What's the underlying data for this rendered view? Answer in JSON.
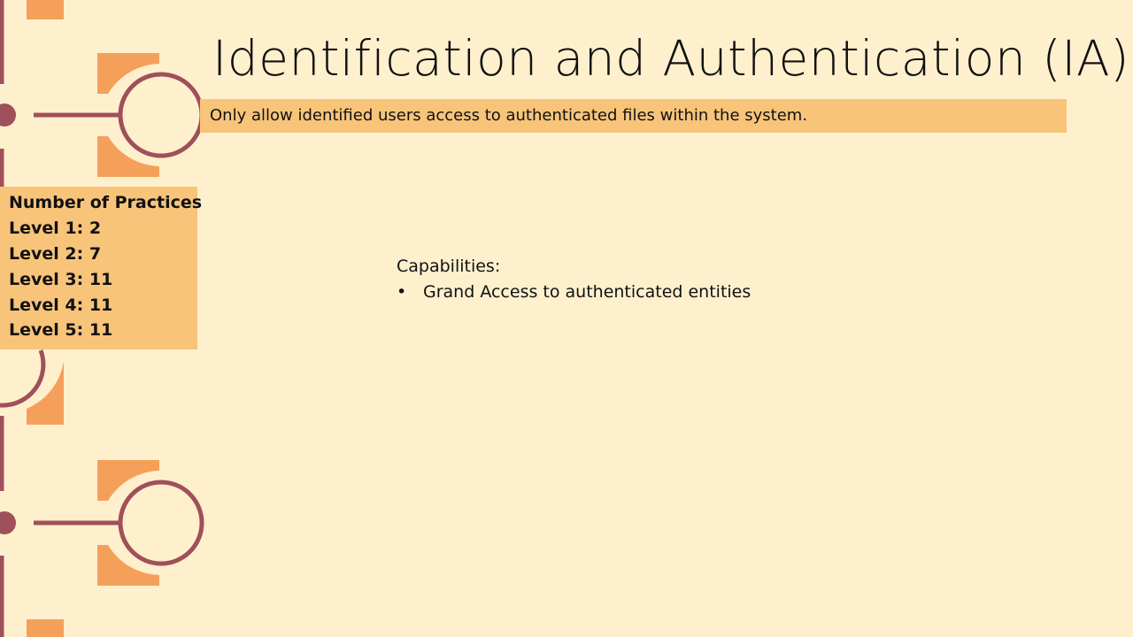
{
  "slide": {
    "title": "Identification and Authentication (IA)",
    "subtitle": "Only allow identified users access to authenticated files within the system.",
    "practices": {
      "heading": "Number of Practices",
      "levels": [
        "Level 1: 2",
        "Level 2: 7",
        "Level 3: 11",
        "Level 4: 11",
        "Level 5: 11"
      ]
    },
    "capabilities": {
      "heading": "Capabilities:",
      "bullet": "•",
      "items": [
        "Grand Access to authenticated entities"
      ]
    }
  },
  "colors": {
    "background": "#fff0cd",
    "accent_bar": "#f7c47a",
    "circuit_line": "#a0505a",
    "decor_orange": "#f5a05a"
  }
}
